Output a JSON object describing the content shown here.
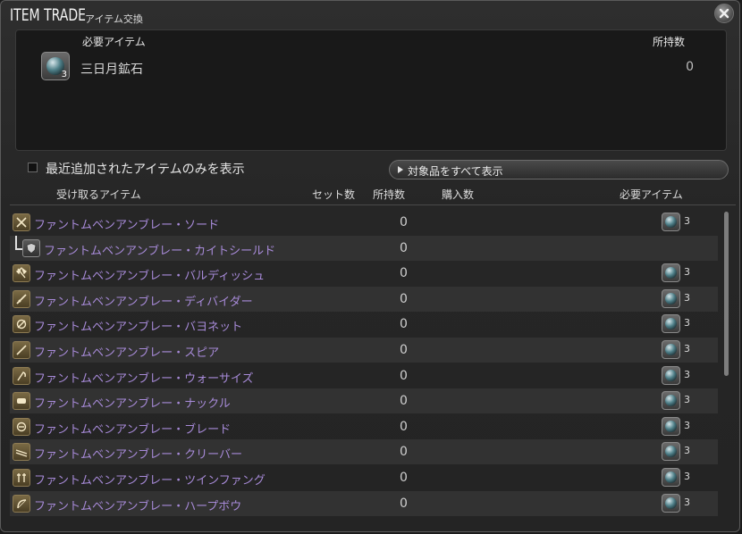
{
  "window": {
    "title": "ITEM TRADE",
    "subtitle": "アイテム交換",
    "close_icon": "close-icon"
  },
  "required": {
    "header": "必要アイテム",
    "owned_header": "所持数",
    "item": {
      "name": "三日月鉱石",
      "count": "3",
      "owned": "0",
      "icon": "ore-icon"
    }
  },
  "filter": {
    "checkbox_label": "最近追加されたアイテムのみを表示",
    "checked": false,
    "show_all_label": "対象品をすべて表示"
  },
  "columns": {
    "receive": "受け取るアイテム",
    "set_count": "セット数",
    "owned": "所持数",
    "purchase": "購入数",
    "required": "必要アイテム"
  },
  "items": [
    {
      "name": "ファントムベンアンブレー・ソード",
      "owned": "0",
      "req": "3",
      "icon": "sword-icon",
      "sub": false
    },
    {
      "name": "ファントムベンアンブレー・カイトシールド",
      "owned": "0",
      "req": "",
      "icon": "shield-icon",
      "sub": true
    },
    {
      "name": "ファントムベンアンブレー・バルディッシュ",
      "owned": "0",
      "req": "3",
      "icon": "axe-icon",
      "sub": false
    },
    {
      "name": "ファントムベンアンブレー・ディバイダー",
      "owned": "0",
      "req": "3",
      "icon": "greatsword-icon",
      "sub": false
    },
    {
      "name": "ファントムベンアンブレー・バヨネット",
      "owned": "0",
      "req": "3",
      "icon": "gunblade-icon",
      "sub": false
    },
    {
      "name": "ファントムベンアンブレー・スピア",
      "owned": "0",
      "req": "3",
      "icon": "spear-icon",
      "sub": false
    },
    {
      "name": "ファントムベンアンブレー・ウォーサイズ",
      "owned": "0",
      "req": "3",
      "icon": "scythe-icon",
      "sub": false
    },
    {
      "name": "ファントムベンアンブレー・ナックル",
      "owned": "0",
      "req": "3",
      "icon": "knuckle-icon",
      "sub": false
    },
    {
      "name": "ファントムベンアンブレー・ブレード",
      "owned": "0",
      "req": "3",
      "icon": "katana-icon",
      "sub": false
    },
    {
      "name": "ファントムベンアンブレー・クリーバー",
      "owned": "0",
      "req": "3",
      "icon": "cleaver-icon",
      "sub": false
    },
    {
      "name": "ファントムベンアンブレー・ツインファング",
      "owned": "0",
      "req": "3",
      "icon": "twinfang-icon",
      "sub": false
    },
    {
      "name": "ファントムベンアンブレー・ハープボウ",
      "owned": "0",
      "req": "3",
      "icon": "bow-icon",
      "sub": false
    }
  ],
  "colors": {
    "item_name": "#a78ad8",
    "background": "#262626",
    "panel": "#191919"
  }
}
